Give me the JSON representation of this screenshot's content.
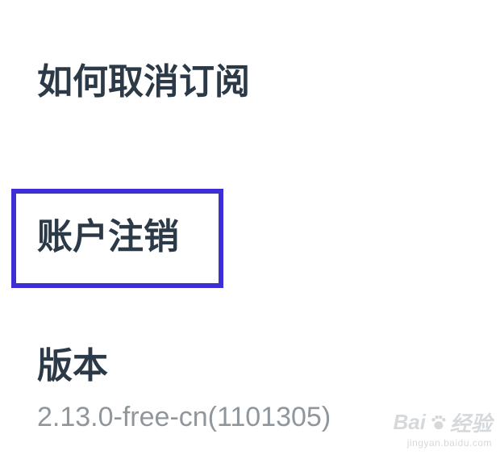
{
  "settings": {
    "items": [
      {
        "label": "如何取消订阅"
      },
      {
        "label": "账户注销",
        "highlighted": true
      },
      {
        "label": "版本",
        "value": "2.13.0-free-cn(1101305)"
      }
    ]
  },
  "colors": {
    "item_text": "#2c3a48",
    "value_text": "#8f969c",
    "highlight_border": "#3d2ed6",
    "watermark": "#d6d9dc"
  },
  "watermark": {
    "brand": "Bai",
    "brand_suffix": "经验",
    "url": "jingyan.baidu.com",
    "icon": "paw-icon"
  }
}
